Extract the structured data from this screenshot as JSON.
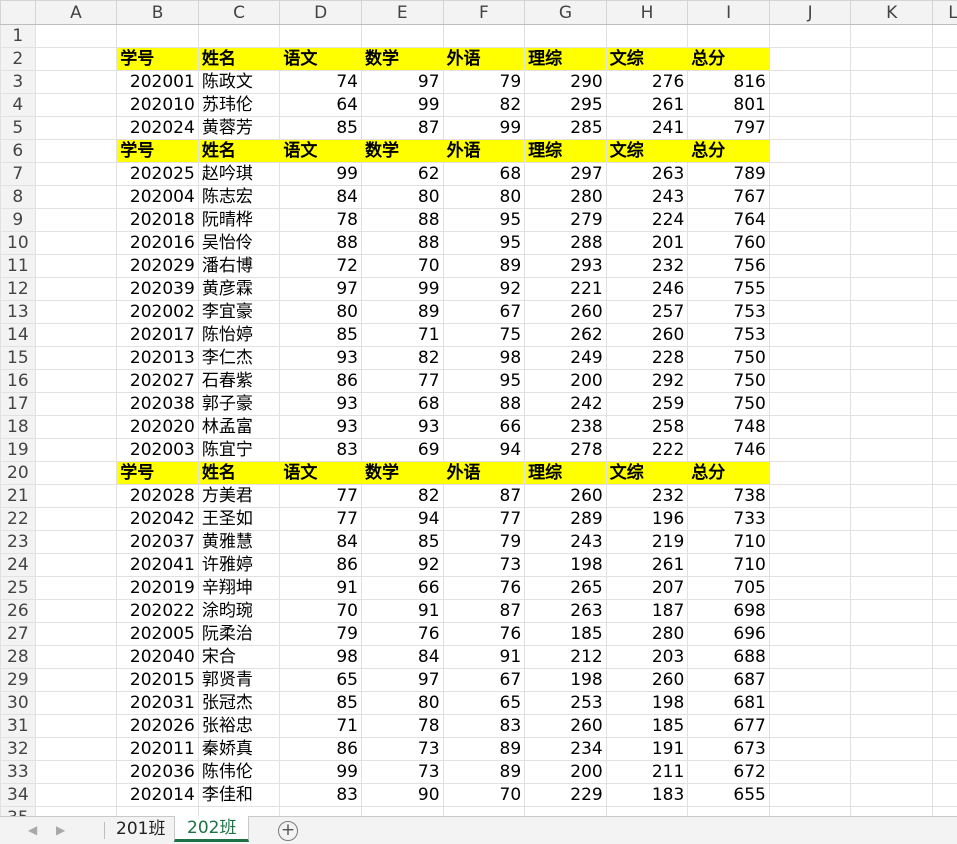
{
  "columns": [
    "A",
    "B",
    "C",
    "D",
    "E",
    "F",
    "G",
    "H",
    "I",
    "J",
    "K",
    "L"
  ],
  "header_labels": [
    "学号",
    "姓名",
    "语文",
    "数学",
    "外语",
    "理综",
    "文综",
    "总分"
  ],
  "header_rows": [
    2,
    6,
    20
  ],
  "students": [
    {
      "row": 3,
      "id": "202001",
      "name": "陈政文",
      "yuwen": 74,
      "shuxue": 97,
      "waiyu": 79,
      "lizong": 290,
      "wenzong": 276,
      "zongfen": 816
    },
    {
      "row": 4,
      "id": "202010",
      "name": "苏玮伦",
      "yuwen": 64,
      "shuxue": 99,
      "waiyu": 82,
      "lizong": 295,
      "wenzong": 261,
      "zongfen": 801
    },
    {
      "row": 5,
      "id": "202024",
      "name": "黄蓉芳",
      "yuwen": 85,
      "shuxue": 87,
      "waiyu": 99,
      "lizong": 285,
      "wenzong": 241,
      "zongfen": 797
    },
    {
      "row": 7,
      "id": "202025",
      "name": "赵吟琪",
      "yuwen": 99,
      "shuxue": 62,
      "waiyu": 68,
      "lizong": 297,
      "wenzong": 263,
      "zongfen": 789
    },
    {
      "row": 8,
      "id": "202004",
      "name": "陈志宏",
      "yuwen": 84,
      "shuxue": 80,
      "waiyu": 80,
      "lizong": 280,
      "wenzong": 243,
      "zongfen": 767
    },
    {
      "row": 9,
      "id": "202018",
      "name": "阮晴桦",
      "yuwen": 78,
      "shuxue": 88,
      "waiyu": 95,
      "lizong": 279,
      "wenzong": 224,
      "zongfen": 764
    },
    {
      "row": 10,
      "id": "202016",
      "name": "吴怡伶",
      "yuwen": 88,
      "shuxue": 88,
      "waiyu": 95,
      "lizong": 288,
      "wenzong": 201,
      "zongfen": 760
    },
    {
      "row": 11,
      "id": "202029",
      "name": "潘右博",
      "yuwen": 72,
      "shuxue": 70,
      "waiyu": 89,
      "lizong": 293,
      "wenzong": 232,
      "zongfen": 756
    },
    {
      "row": 12,
      "id": "202039",
      "name": "黄彦霖",
      "yuwen": 97,
      "shuxue": 99,
      "waiyu": 92,
      "lizong": 221,
      "wenzong": 246,
      "zongfen": 755
    },
    {
      "row": 13,
      "id": "202002",
      "name": "李宜豪",
      "yuwen": 80,
      "shuxue": 89,
      "waiyu": 67,
      "lizong": 260,
      "wenzong": 257,
      "zongfen": 753
    },
    {
      "row": 14,
      "id": "202017",
      "name": "陈怡婷",
      "yuwen": 85,
      "shuxue": 71,
      "waiyu": 75,
      "lizong": 262,
      "wenzong": 260,
      "zongfen": 753
    },
    {
      "row": 15,
      "id": "202013",
      "name": "李仁杰",
      "yuwen": 93,
      "shuxue": 82,
      "waiyu": 98,
      "lizong": 249,
      "wenzong": 228,
      "zongfen": 750
    },
    {
      "row": 16,
      "id": "202027",
      "name": "石春紫",
      "yuwen": 86,
      "shuxue": 77,
      "waiyu": 95,
      "lizong": 200,
      "wenzong": 292,
      "zongfen": 750
    },
    {
      "row": 17,
      "id": "202038",
      "name": "郭子豪",
      "yuwen": 93,
      "shuxue": 68,
      "waiyu": 88,
      "lizong": 242,
      "wenzong": 259,
      "zongfen": 750
    },
    {
      "row": 18,
      "id": "202020",
      "name": "林孟富",
      "yuwen": 93,
      "shuxue": 93,
      "waiyu": 66,
      "lizong": 238,
      "wenzong": 258,
      "zongfen": 748
    },
    {
      "row": 19,
      "id": "202003",
      "name": "陈宜宁",
      "yuwen": 83,
      "shuxue": 69,
      "waiyu": 94,
      "lizong": 278,
      "wenzong": 222,
      "zongfen": 746
    },
    {
      "row": 21,
      "id": "202028",
      "name": "方美君",
      "yuwen": 77,
      "shuxue": 82,
      "waiyu": 87,
      "lizong": 260,
      "wenzong": 232,
      "zongfen": 738
    },
    {
      "row": 22,
      "id": "202042",
      "name": "王圣如",
      "yuwen": 77,
      "shuxue": 94,
      "waiyu": 77,
      "lizong": 289,
      "wenzong": 196,
      "zongfen": 733
    },
    {
      "row": 23,
      "id": "202037",
      "name": "黄雅慧",
      "yuwen": 84,
      "shuxue": 85,
      "waiyu": 79,
      "lizong": 243,
      "wenzong": 219,
      "zongfen": 710
    },
    {
      "row": 24,
      "id": "202041",
      "name": "许雅婷",
      "yuwen": 86,
      "shuxue": 92,
      "waiyu": 73,
      "lizong": 198,
      "wenzong": 261,
      "zongfen": 710
    },
    {
      "row": 25,
      "id": "202019",
      "name": "辛翔坤",
      "yuwen": 91,
      "shuxue": 66,
      "waiyu": 76,
      "lizong": 265,
      "wenzong": 207,
      "zongfen": 705
    },
    {
      "row": 26,
      "id": "202022",
      "name": "涂昀琬",
      "yuwen": 70,
      "shuxue": 91,
      "waiyu": 87,
      "lizong": 263,
      "wenzong": 187,
      "zongfen": 698
    },
    {
      "row": 27,
      "id": "202005",
      "name": "阮柔治",
      "yuwen": 79,
      "shuxue": 76,
      "waiyu": 76,
      "lizong": 185,
      "wenzong": 280,
      "zongfen": 696
    },
    {
      "row": 28,
      "id": "202040",
      "name": "宋合",
      "yuwen": 98,
      "shuxue": 84,
      "waiyu": 91,
      "lizong": 212,
      "wenzong": 203,
      "zongfen": 688
    },
    {
      "row": 29,
      "id": "202015",
      "name": "郭贤青",
      "yuwen": 65,
      "shuxue": 97,
      "waiyu": 67,
      "lizong": 198,
      "wenzong": 260,
      "zongfen": 687
    },
    {
      "row": 30,
      "id": "202031",
      "name": "张冠杰",
      "yuwen": 85,
      "shuxue": 80,
      "waiyu": 65,
      "lizong": 253,
      "wenzong": 198,
      "zongfen": 681
    },
    {
      "row": 31,
      "id": "202026",
      "name": "张裕忠",
      "yuwen": 71,
      "shuxue": 78,
      "waiyu": 83,
      "lizong": 260,
      "wenzong": 185,
      "zongfen": 677
    },
    {
      "row": 32,
      "id": "202011",
      "name": "秦娇真",
      "yuwen": 86,
      "shuxue": 73,
      "waiyu": 89,
      "lizong": 234,
      "wenzong": 191,
      "zongfen": 673
    },
    {
      "row": 33,
      "id": "202036",
      "name": "陈伟伦",
      "yuwen": 99,
      "shuxue": 73,
      "waiyu": 89,
      "lizong": 200,
      "wenzong": 211,
      "zongfen": 672
    },
    {
      "row": 34,
      "id": "202014",
      "name": "李佳和",
      "yuwen": 83,
      "shuxue": 90,
      "waiyu": 70,
      "lizong": 229,
      "wenzong": 183,
      "zongfen": 655
    }
  ],
  "sheet_tabs": [
    {
      "label": "201班",
      "active": false
    },
    {
      "label": "202班",
      "active": true
    }
  ],
  "icons": {
    "prev": "chevron-left-icon",
    "next": "chevron-right-icon",
    "add": "add-sheet-icon"
  },
  "colors": {
    "header_fill": "#ffff00",
    "active_tab": "#1e7145"
  }
}
